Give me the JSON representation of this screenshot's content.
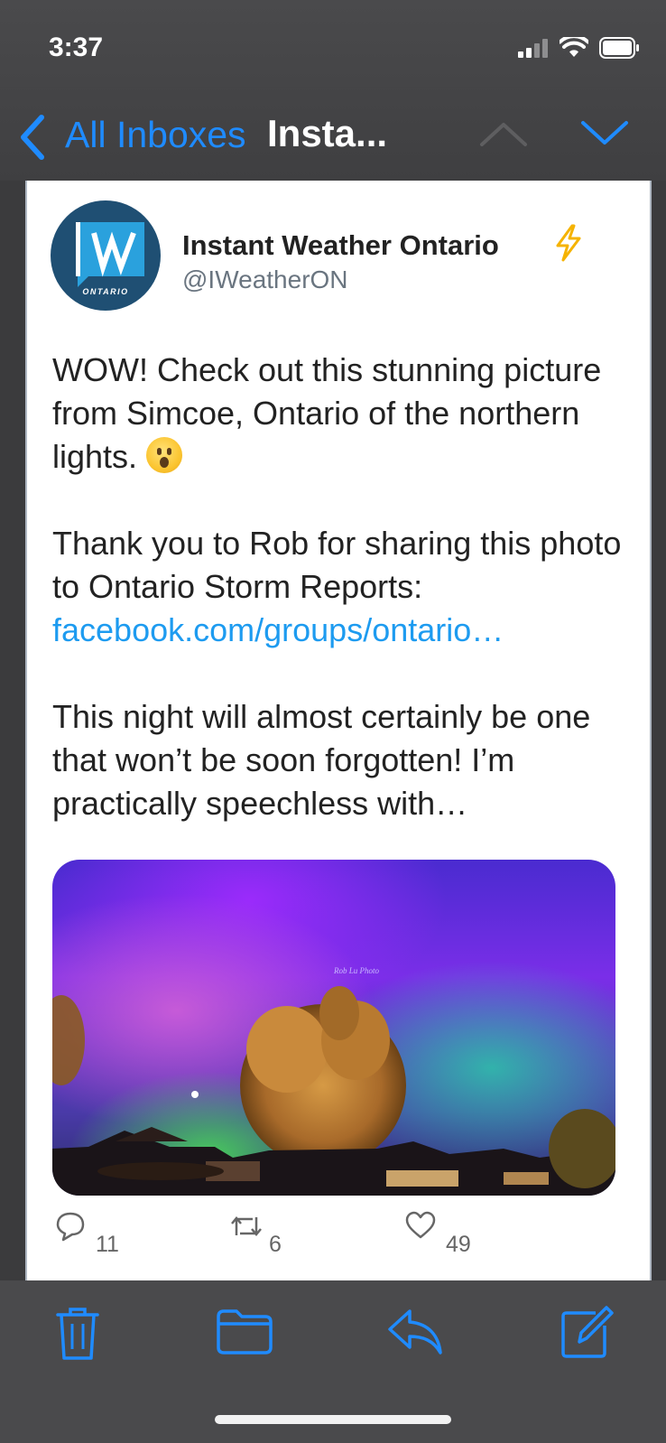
{
  "status_bar": {
    "time": "3:37"
  },
  "nav": {
    "back_label": "All Inboxes",
    "title": "Insta..."
  },
  "tweet": {
    "author_name": "Instant Weather Ontario",
    "handle": "@IWeatherON",
    "avatar_text": "IW",
    "avatar_sub": "ONTARIO",
    "paragraphs": [
      "WOW! Check out this stunning picture from Simcoe, Ontario of the northern lights.",
      "Thank you to Rob for sharing this photo to Ontario Storm Reports:",
      "facebook.com/groups/ontario…",
      "This night will almost certainly be one that won’t be soon forgotten! I’m practically speechless with…"
    ],
    "image_watermark": "Rob Lu Photo",
    "replies": "11",
    "retweets": "6",
    "likes": "49"
  },
  "colors": {
    "accent": "#1f8bff",
    "link": "#1d9bf0",
    "bar": "#4a4a4c"
  },
  "icons": [
    "back-chevron-icon",
    "up-chevron-icon",
    "down-chevron-icon",
    "trash-icon",
    "folder-icon",
    "reply-icon",
    "compose-icon",
    "reply-bubble-icon",
    "retweet-icon",
    "heart-icon",
    "lightning-icon"
  ]
}
